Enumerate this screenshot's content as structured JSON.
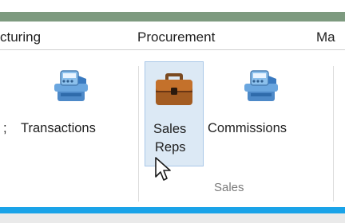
{
  "menu": {
    "items": [
      "cturing",
      "Procurement",
      "Ma"
    ]
  },
  "ribbon": {
    "left_fragment": ";",
    "transactions_label": "Transactions",
    "sales_reps_label_line1": "Sales",
    "sales_reps_label_line2": "Reps",
    "commissions_label": "Commissions",
    "group_label": "Sales"
  },
  "icons": {
    "transactions": "cash-register-icon",
    "sales_reps": "briefcase-icon",
    "commissions": "cash-register-icon",
    "cursor": "mouse-pointer-icon"
  },
  "colors": {
    "green_bar": "#7d9a7f",
    "selected_bg": "#dce9f5",
    "selected_border": "#a9c7e8",
    "blue_bar": "#1aa3e8"
  }
}
